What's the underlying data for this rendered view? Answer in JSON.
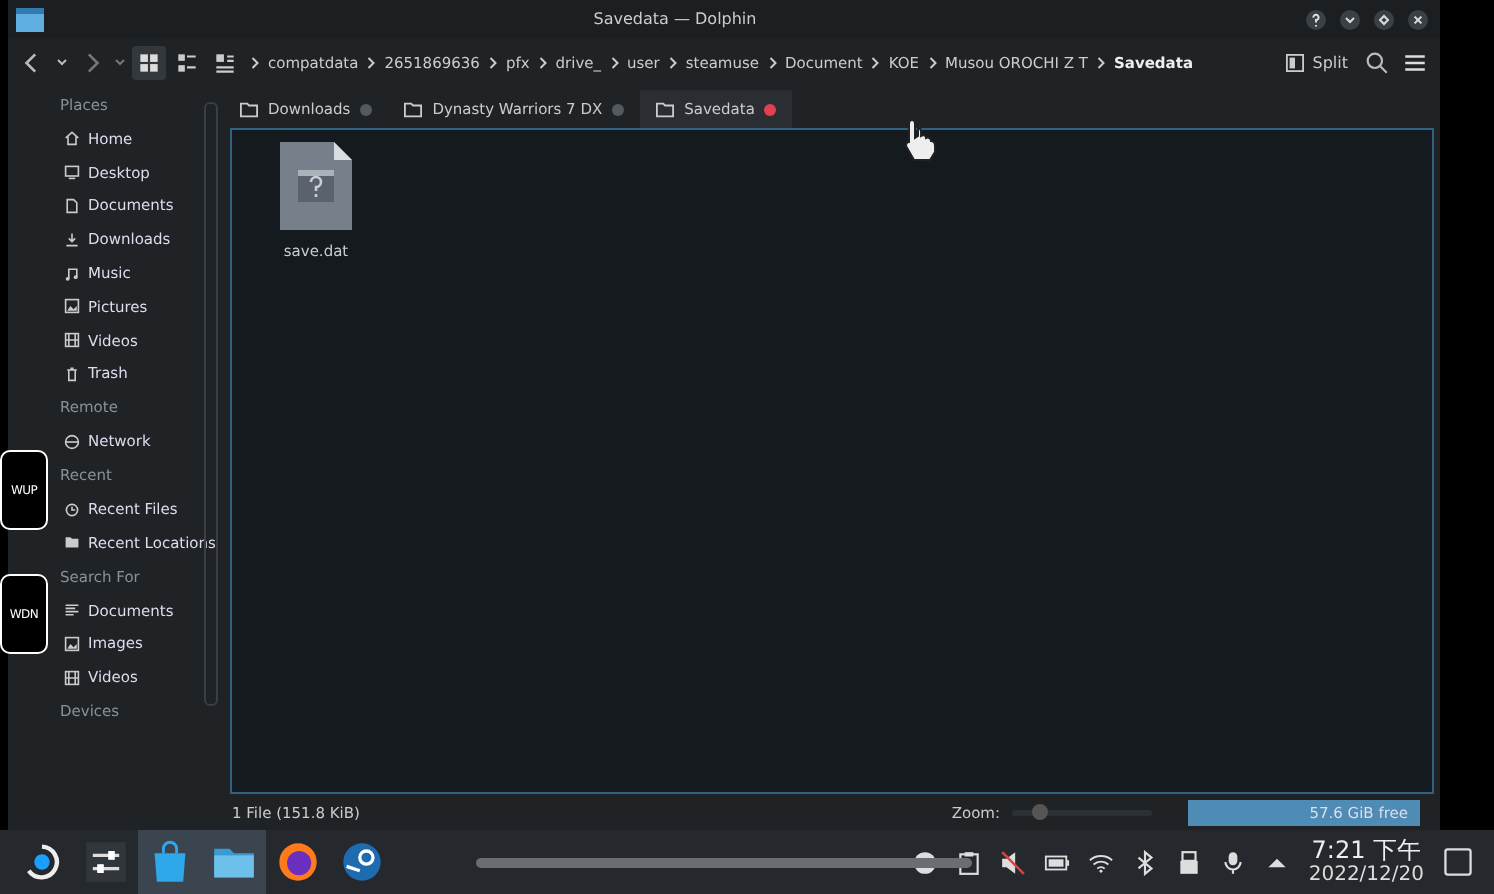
{
  "window": {
    "title": "Savedata — Dolphin"
  },
  "toolbar": {
    "breadcrumb": [
      {
        "label": "compatdata",
        "current": false
      },
      {
        "label": "2651869636",
        "current": false
      },
      {
        "label": "pfx",
        "current": false
      },
      {
        "label": "drive_",
        "current": false
      },
      {
        "label": "user",
        "current": false
      },
      {
        "label": "steamuse",
        "current": false
      },
      {
        "label": "Document",
        "current": false
      },
      {
        "label": "KOE",
        "current": false
      },
      {
        "label": "Musou OROCHI Z T",
        "current": false
      },
      {
        "label": "Savedata",
        "current": true
      }
    ],
    "split": "Split"
  },
  "sidebar": {
    "sections": [
      {
        "title": "Places",
        "items": [
          {
            "label": "Home",
            "kind": "home"
          },
          {
            "label": "Desktop",
            "kind": "desktop"
          },
          {
            "label": "Documents",
            "kind": "document"
          },
          {
            "label": "Downloads",
            "kind": "download"
          },
          {
            "label": "Music",
            "kind": "music"
          },
          {
            "label": "Pictures",
            "kind": "picture"
          },
          {
            "label": "Videos",
            "kind": "video"
          },
          {
            "label": "Trash",
            "kind": "trash"
          }
        ]
      },
      {
        "title": "Remote",
        "items": [
          {
            "label": "Network",
            "kind": "network"
          }
        ]
      },
      {
        "title": "Recent",
        "items": [
          {
            "label": "Recent Files",
            "kind": "recent"
          },
          {
            "label": "Recent Locations",
            "kind": "folder"
          }
        ]
      },
      {
        "title": "Search For",
        "items": [
          {
            "label": "Documents",
            "kind": "lines"
          },
          {
            "label": "Images",
            "kind": "picture"
          },
          {
            "label": "Videos",
            "kind": "video"
          }
        ]
      },
      {
        "title": "Devices"
      }
    ]
  },
  "tabs": [
    {
      "label": "Downloads",
      "selected": false
    },
    {
      "label": "Dynasty Warriors 7 DX",
      "selected": false
    },
    {
      "label": "Savedata",
      "selected": true
    }
  ],
  "files": [
    {
      "name": "save.dat"
    }
  ],
  "status": {
    "text": "1 File (151.8 KiB)",
    "zoom_label": "Zoom:",
    "zoom": {
      "level": 0.2
    },
    "free": "57.6 GiB free"
  },
  "overlay_buttons": [
    "WUP",
    "WDN"
  ],
  "taskbar": {
    "apps": [
      {
        "kind": "launcher",
        "selected": false
      },
      {
        "kind": "mixer",
        "selected": false
      },
      {
        "kind": "store",
        "selected": true
      },
      {
        "kind": "files",
        "selected": true
      },
      {
        "kind": "browser",
        "selected": false
      },
      {
        "kind": "steam",
        "selected": false
      }
    ],
    "time": "7:21 下午",
    "date": "2022/12/20"
  }
}
